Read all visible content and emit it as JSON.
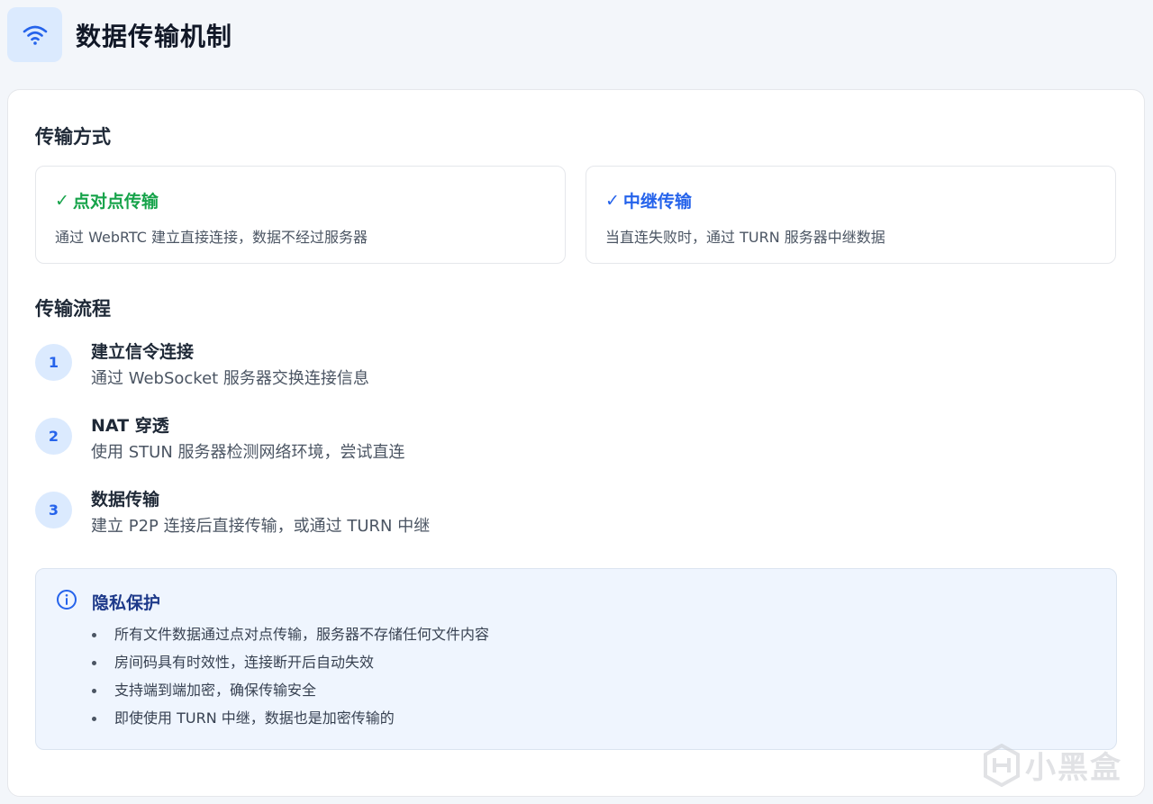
{
  "header": {
    "icon": "wifi-icon",
    "title": "数据传输机制"
  },
  "colors": {
    "accent_blue": "#2563eb",
    "accent_green": "#16a34a",
    "icon_bg": "#dbeafe",
    "info_bg": "#eff5fe"
  },
  "methods": {
    "section_title": "传输方式",
    "items": [
      {
        "check": "✓",
        "title": "点对点传输",
        "desc": "通过 WebRTC 建立直接连接，数据不经过服务器"
      },
      {
        "check": "✓",
        "title": "中继传输",
        "desc": "当直连失败时，通过 TURN 服务器中继数据"
      }
    ]
  },
  "flow": {
    "section_title": "传输流程",
    "steps": [
      {
        "num": "1",
        "title": "建立信令连接",
        "desc": "通过 WebSocket 服务器交换连接信息"
      },
      {
        "num": "2",
        "title": "NAT 穿透",
        "desc": "使用 STUN 服务器检测网络环境，尝试直连"
      },
      {
        "num": "3",
        "title": "数据传输",
        "desc": "建立 P2P 连接后直接传输，或通过 TURN 中继"
      }
    ]
  },
  "privacy": {
    "icon": "info-icon",
    "title": "隐私保护",
    "items": [
      "所有文件数据通过点对点传输，服务器不存储任何文件内容",
      "房间码具有时效性，连接断开后自动失效",
      "支持端到端加密，确保传输安全",
      "即使使用 TURN 中继，数据也是加密传输的"
    ]
  },
  "watermark": {
    "text": "小黑盒"
  }
}
